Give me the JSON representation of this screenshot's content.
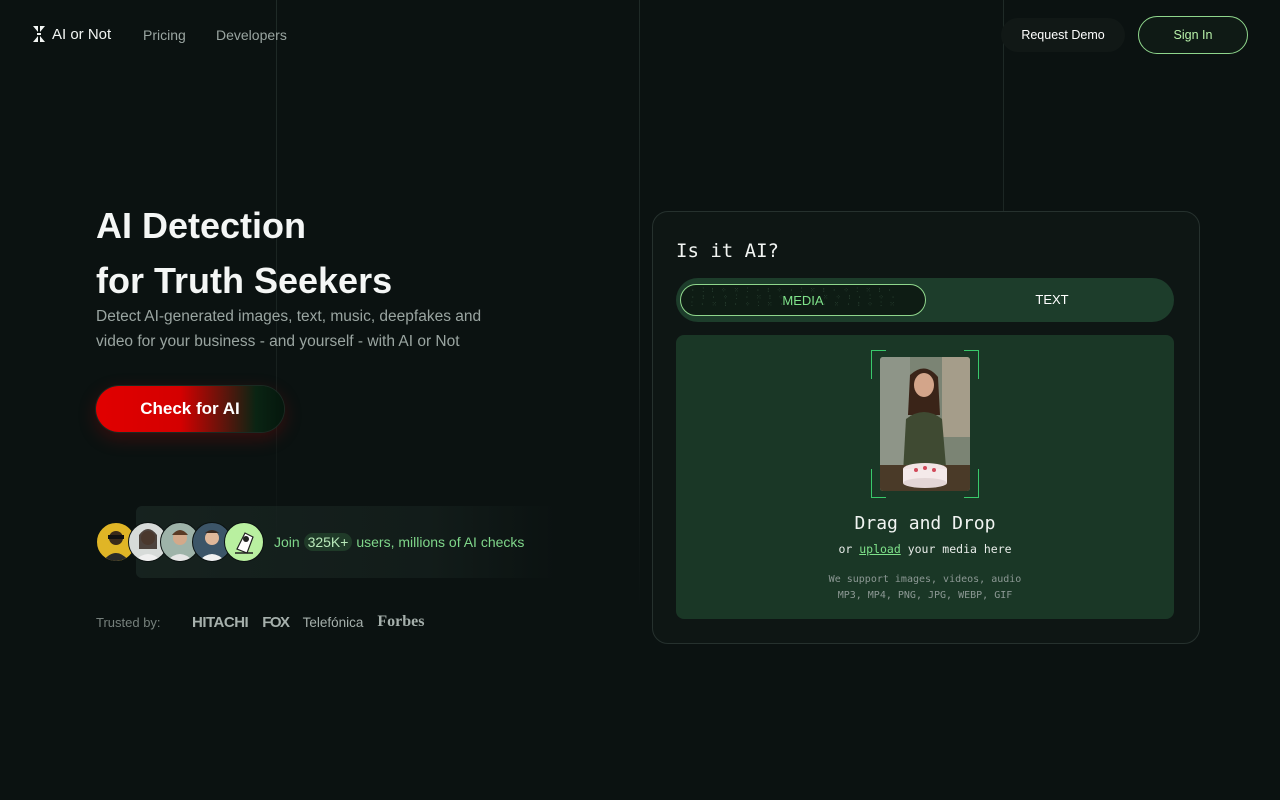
{
  "header": {
    "logo_text": "AI or Not",
    "nav": [
      {
        "label": "Pricing"
      },
      {
        "label": "Developers"
      }
    ],
    "request_demo_label": "Request Demo",
    "sign_in_label": "Sign In"
  },
  "hero": {
    "title_line1": "AI Detection",
    "title_line2": "for Truth Seekers",
    "subtitle": "Detect AI-generated images, text, music, deepfakes and video for your business - and yourself - with AI or Not",
    "cta_label": "Check for AI"
  },
  "social": {
    "text_before": "Join ",
    "count": "325K+",
    "text_after": " users, millions of AI checks"
  },
  "trusted": {
    "label": "Trusted by:",
    "brands": [
      "HITACHI",
      "FOX",
      "Telefónica",
      "Forbes"
    ]
  },
  "card": {
    "title": "Is it AI?",
    "tabs": [
      {
        "label": "MEDIA",
        "active": true
      },
      {
        "label": "TEXT",
        "active": false
      }
    ],
    "drop_title": "Drag and Drop",
    "drop_sub_before": "or ",
    "drop_sub_link": "upload",
    "drop_sub_after": " your media here",
    "support_line1": "We support images, videos, audio",
    "support_line2": "MP3, MP4, PNG, JPG, WEBP, GIF"
  },
  "colors": {
    "background": "#0b1211",
    "accent_green": "#7fe28a",
    "cta_red": "#e10000",
    "panel_green": "#1a3726"
  }
}
